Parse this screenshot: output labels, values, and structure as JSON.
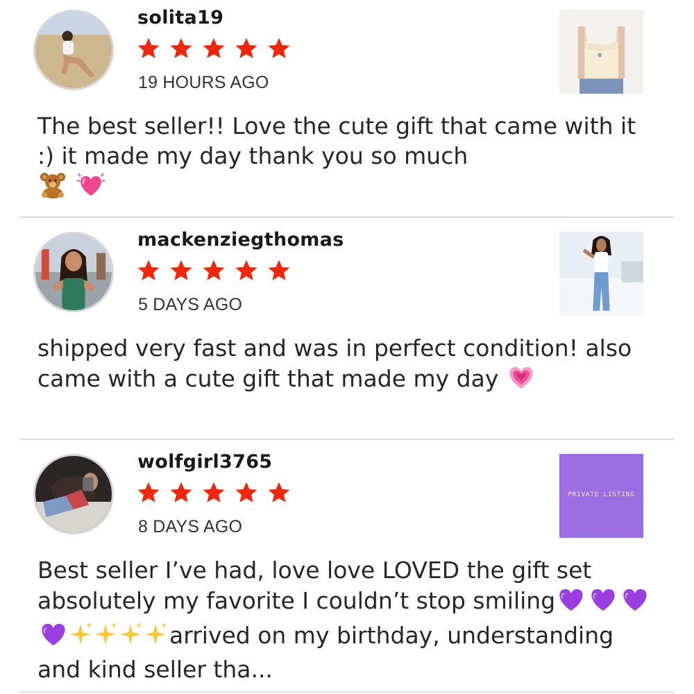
{
  "reviews": [
    {
      "username": "solita19",
      "rating": 5,
      "time": "19 HOURS AGO",
      "text": "The best seller!! Love the cute gift that came with it :) it made my day thank you so much",
      "emojis": [
        "teddy-bear",
        "beating-heart"
      ]
    },
    {
      "username": "mackenziegthomas",
      "rating": 5,
      "time": "5 DAYS AGO",
      "text": "shipped very fast and was in perfect condition! also came with a cute gift that made my day",
      "emojis": [
        "growing-heart"
      ]
    },
    {
      "username": "wolfgirl3765",
      "rating": 5,
      "time": "8 DAYS AGO",
      "text_before": "Best seller I’ve had, love love LOVED the gift set absolutely my favorite I couldn’t stop smiling",
      "text_after": "arrived on my birthday, understanding and kind seller tha...",
      "emojis": [
        "purple-heart",
        "purple-heart",
        "purple-heart",
        "purple-heart",
        "sparkles",
        "sparkles",
        "sparkles",
        "sparkles"
      ],
      "thumbnail_label": "PRIVATE LISTING"
    }
  ],
  "colors": {
    "star": "#f2260a",
    "private_listing_bg": "#9b6ee4"
  }
}
